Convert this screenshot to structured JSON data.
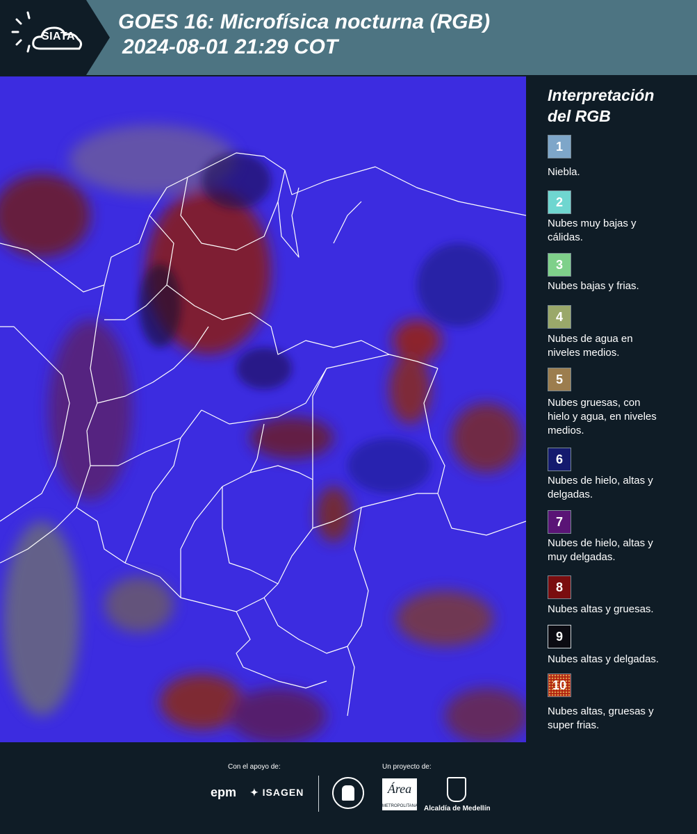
{
  "header": {
    "logo_text": "SIATA",
    "title_line1": "GOES 16: Microfísica nocturna (RGB)",
    "title_line2": "2024-08-01 21:29 COT"
  },
  "legend": {
    "title_line1": "Interpretación",
    "title_line2": "del RGB",
    "items": [
      {
        "number": "1",
        "color": "#7ea6c9",
        "line1": "Niebla.",
        "line2": ""
      },
      {
        "number": "2",
        "color": "#6fd6d0",
        "line1": "Nubes muy bajas y",
        "line2": "cálidas."
      },
      {
        "number": "3",
        "color": "#7fd08a",
        "line1": "Nubes bajas y frias.",
        "line2": ""
      },
      {
        "number": "4",
        "color": "#9aa86a",
        "line1": "Nubes de agua en",
        "line2": "niveles medios."
      },
      {
        "number": "5",
        "color": "#9c7d4e",
        "line1": "Nubes gruesas, con",
        "line2": "hielo y agua, en niveles",
        "line3": "medios."
      },
      {
        "number": "6",
        "color": "#141a6e",
        "line1": "Nubes de hielo, altas y",
        "line2": "delgadas."
      },
      {
        "number": "7",
        "color": "#5a1476",
        "line1": "Nubes de hielo, altas y",
        "line2": "muy delgadas."
      },
      {
        "number": "8",
        "color": "#7a0d0f",
        "line1": "Nubes altas y gruesas.",
        "line2": ""
      },
      {
        "number": "9",
        "color": "#0b0b12",
        "line1": "Nubes altas y delgadas.",
        "line2": ""
      },
      {
        "number": "10",
        "color": "#b0210f",
        "line1": "Nubes altas, gruesas y",
        "line2": "super frias."
      }
    ]
  },
  "footer": {
    "support_label": "Con el apoyo de:",
    "project_label": "Un proyecto de:",
    "epm_text": "epm",
    "isagen_text": "ISAGEN",
    "area_logo_text": "Área",
    "area_logo_sub": "METROPOLITANA",
    "medellin_text": "Alcaldía de Medellín"
  },
  "colors": {
    "header_bg": "#4d7482",
    "dark_bg": "#0f1c26",
    "map_base": "#3c2ce0"
  }
}
